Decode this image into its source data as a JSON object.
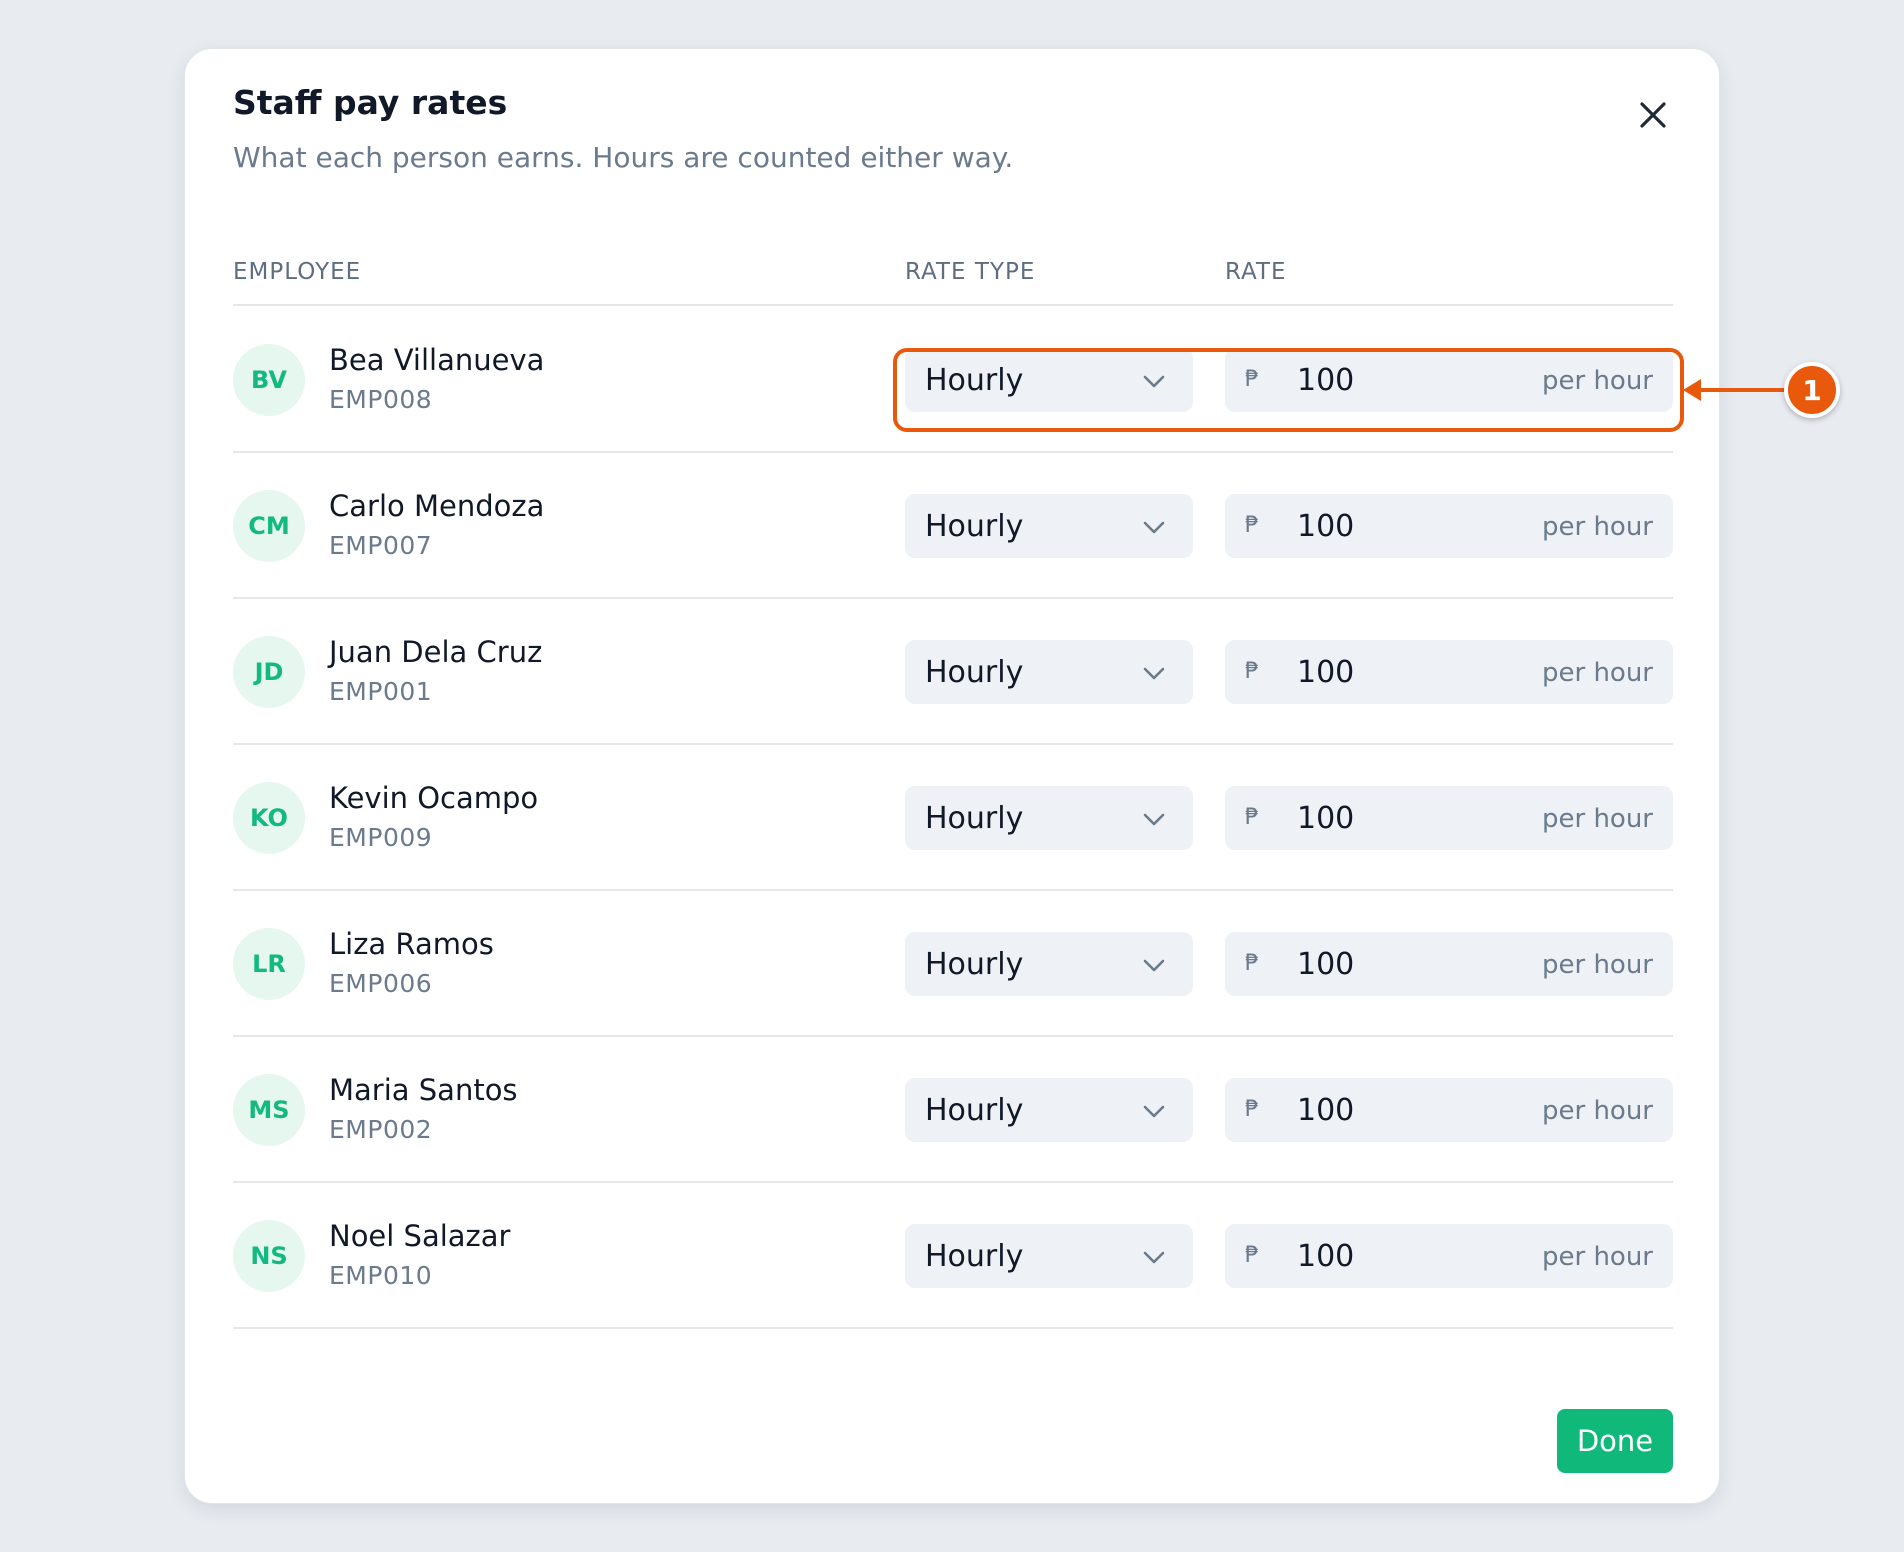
{
  "dialog": {
    "title": "Staff pay rates",
    "subtitle": "What each person earns. Hours are counted either way.",
    "done_label": "Done"
  },
  "table": {
    "headers": [
      "EMPLOYEE",
      "RATE TYPE",
      "RATE"
    ],
    "rows": [
      {
        "initials": "BV",
        "name": "Bea Villanueva",
        "id": "EMP008",
        "rate_type": "Hourly",
        "currency": "₱",
        "rate": "100",
        "unit": "per hour"
      },
      {
        "initials": "CM",
        "name": "Carlo Mendoza",
        "id": "EMP007",
        "rate_type": "Hourly",
        "currency": "₱",
        "rate": "100",
        "unit": "per hour"
      },
      {
        "initials": "JD",
        "name": "Juan Dela Cruz",
        "id": "EMP001",
        "rate_type": "Hourly",
        "currency": "₱",
        "rate": "100",
        "unit": "per hour"
      },
      {
        "initials": "KO",
        "name": "Kevin Ocampo",
        "id": "EMP009",
        "rate_type": "Hourly",
        "currency": "₱",
        "rate": "100",
        "unit": "per hour"
      },
      {
        "initials": "LR",
        "name": "Liza Ramos",
        "id": "EMP006",
        "rate_type": "Hourly",
        "currency": "₱",
        "rate": "100",
        "unit": "per hour"
      },
      {
        "initials": "MS",
        "name": "Maria Santos",
        "id": "EMP002",
        "rate_type": "Hourly",
        "currency": "₱",
        "rate": "100",
        "unit": "per hour"
      },
      {
        "initials": "NS",
        "name": "Noel Salazar",
        "id": "EMP010",
        "rate_type": "Hourly",
        "currency": "₱",
        "rate": "100",
        "unit": "per hour"
      }
    ]
  },
  "annotation": {
    "badge": "1"
  },
  "icons": {
    "close": "close-icon",
    "dropdown": "chevron-down-icon"
  },
  "colors": {
    "accent": "#10b97a",
    "avatar_bg": "#e6f7ef",
    "avatar_text": "#12b981",
    "annotation": "#e8590c"
  }
}
